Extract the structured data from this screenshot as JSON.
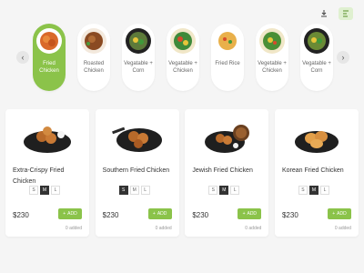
{
  "header": {
    "icons": [
      "download-icon",
      "menu-icon"
    ]
  },
  "categories": {
    "items": [
      {
        "label": "Fried Chicken",
        "active": true
      },
      {
        "label": "Roasted Chicken",
        "active": false
      },
      {
        "label": "Vegatable + Corn",
        "active": false
      },
      {
        "label": "Vegatable + Chicken",
        "active": false
      },
      {
        "label": "Fried Rice",
        "active": false
      },
      {
        "label": "Vegetable + Chicken",
        "active": false
      },
      {
        "label": "Vegatable + Corn",
        "active": false
      }
    ]
  },
  "products": [
    {
      "name": "Extra-Crispy  Fried Chicken",
      "sizes": [
        "S",
        "M",
        "L"
      ],
      "selected_size": "M",
      "price": "$230",
      "add_label": "ADD",
      "added_text": "0 added"
    },
    {
      "name": "Southern Fried Chicken",
      "sizes": [
        "S",
        "M",
        "L"
      ],
      "selected_size": "S",
      "price": "$230",
      "add_label": "ADD",
      "added_text": "0 added"
    },
    {
      "name": "Jewish Fried Chicken",
      "sizes": [
        "S",
        "M",
        "L"
      ],
      "selected_size": "M",
      "price": "$230",
      "add_label": "ADD",
      "added_text": "0 added"
    },
    {
      "name": "Korean Fried Chicken",
      "sizes": [
        "S",
        "M",
        "L"
      ],
      "selected_size": "M",
      "price": "$230",
      "add_label": "ADD",
      "added_text": "0 added"
    }
  ],
  "colors": {
    "accent": "#8bc34a",
    "background": "#f5f5f5"
  }
}
